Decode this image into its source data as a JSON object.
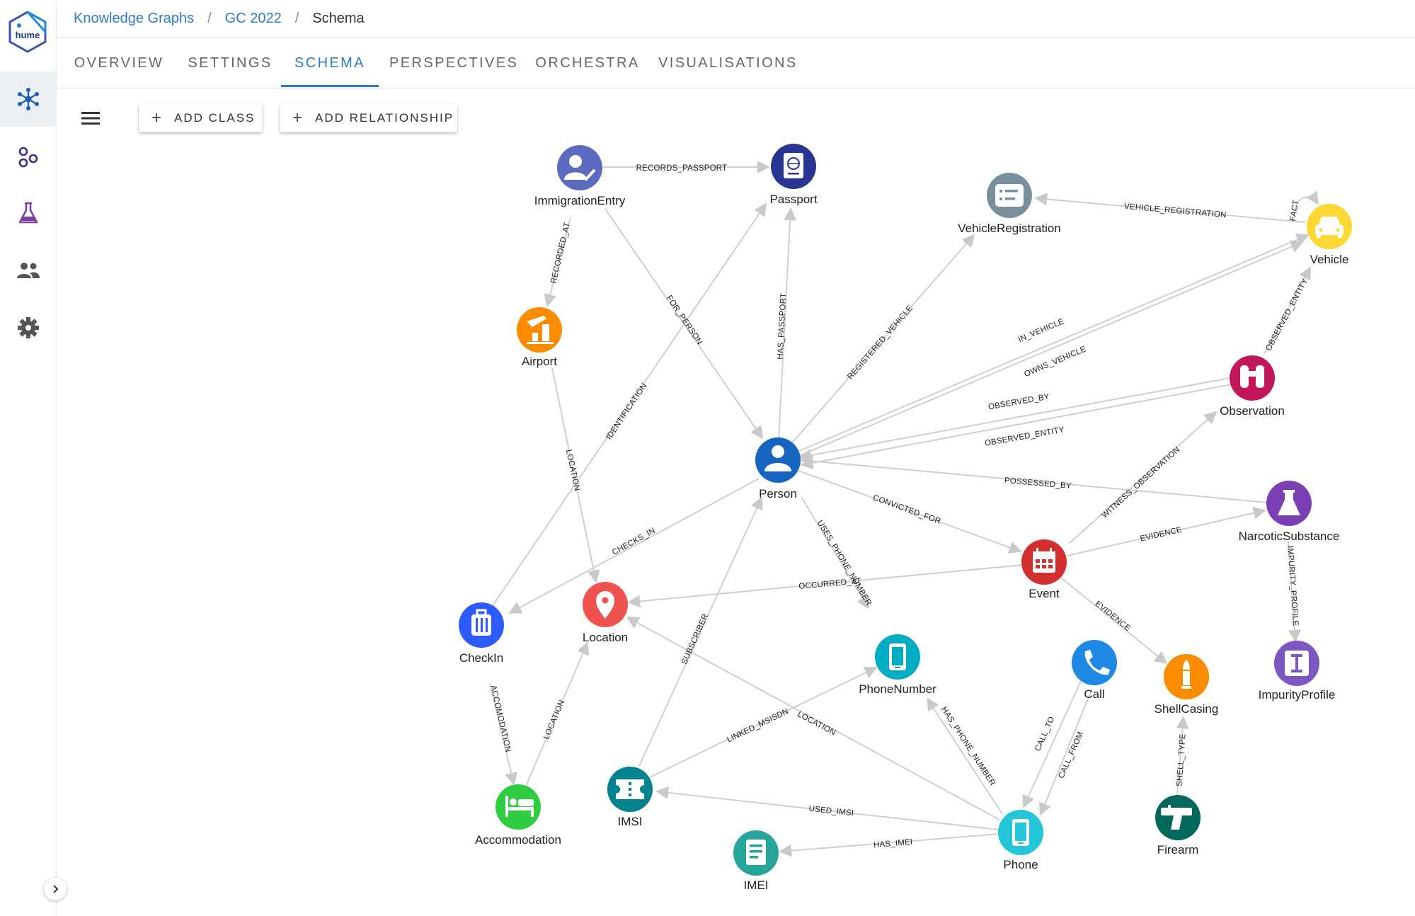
{
  "app": {
    "logo_text": "hume"
  },
  "breadcrumb": {
    "item1": "Knowledge Graphs",
    "item2": "GC 2022",
    "current": "Schema",
    "separator": "/"
  },
  "tabs": {
    "overview": "OVERVIEW",
    "settings": "SETTINGS",
    "schema": "SCHEMA",
    "perspectives": "PERSPECTIVES",
    "orchestra": "ORCHESTRA",
    "visualisations": "VISUALISATIONS"
  },
  "toolbar": {
    "add_class": "ADD CLASS",
    "add_relationship": "ADD RELATIONSHIP",
    "plus": "+"
  },
  "sidebar": {
    "items": [
      {
        "icon": "graph-network-icon",
        "active": true
      },
      {
        "icon": "nodes-icon",
        "active": false
      },
      {
        "icon": "flask-icon",
        "active": false
      },
      {
        "icon": "people-icon",
        "active": false
      },
      {
        "icon": "gear-icon",
        "active": false
      }
    ]
  },
  "colors": {
    "accent": "#2d7bc4",
    "edge": "#cccccc"
  },
  "graph": {
    "nodes": {
      "immigration_entry": {
        "label": "ImmigrationEntry",
        "color": "#5c6bc0",
        "icon": "person-check-icon"
      },
      "passport": {
        "label": "Passport",
        "color": "#283593",
        "icon": "passport-icon"
      },
      "vehicle_registration": {
        "label": "VehicleRegistration",
        "color": "#78909c",
        "icon": "list-card-icon"
      },
      "vehicle": {
        "label": "Vehicle",
        "color": "#fdd835",
        "icon": "car-icon"
      },
      "airport": {
        "label": "Airport",
        "color": "#fb8c00",
        "icon": "airport-icon"
      },
      "observation": {
        "label": "Observation",
        "color": "#c2185b",
        "icon": "binoculars-icon"
      },
      "person": {
        "label": "Person",
        "color": "#1565c0",
        "icon": "person-icon"
      },
      "narcotic_substance": {
        "label": "NarcoticSubstance",
        "color": "#7b3fb5",
        "icon": "flask-icon"
      },
      "event": {
        "label": "Event",
        "color": "#d32f2f",
        "icon": "calendar-icon"
      },
      "checkin": {
        "label": "CheckIn",
        "color": "#2d5bff",
        "icon": "luggage-icon"
      },
      "location": {
        "label": "Location",
        "color": "#ef5350",
        "icon": "location-pin-icon"
      },
      "phone_number": {
        "label": "PhoneNumber",
        "color": "#00acc1",
        "icon": "smartphone-icon"
      },
      "call": {
        "label": "Call",
        "color": "#1e88e5",
        "icon": "phone-call-icon"
      },
      "shell_casing": {
        "label": "ShellCasing",
        "color": "#fb8c00",
        "icon": "bullet-icon"
      },
      "impurity_profile": {
        "label": "ImpurityProfile",
        "color": "#7e57c2",
        "icon": "text-cursor-icon"
      },
      "accommodation": {
        "label": "Accommodation",
        "color": "#2ecc40",
        "icon": "bed-icon"
      },
      "imsi": {
        "label": "IMSI",
        "color": "#00838f",
        "icon": "sim-ticket-icon"
      },
      "phone": {
        "label": "Phone",
        "color": "#26c6da",
        "icon": "smartphone-icon"
      },
      "firearm": {
        "label": "Firearm",
        "color": "#00695c",
        "icon": "pistol-icon"
      },
      "imei": {
        "label": "IMEI",
        "color": "#26a69a",
        "icon": "document-icon"
      }
    },
    "edges": {
      "records_passport": "RECORDS_PASSPORT",
      "recorded_at": "RECORDED_AT",
      "for_person": "FOR_PERSON",
      "has_passport": "HAS_PASSPORT",
      "identification": "IDENTIFICATION",
      "vehicle_registration": "VEHICLE_REGISTRATION",
      "fact": "FACT",
      "registered_vehicle": "REGISTERED_VEHICLE",
      "in_vehicle": "IN_VEHICLE",
      "owns_vehicle": "OWNS_VEHICLE",
      "observed_entity_vehicle": "OBSERVED_ENTITY",
      "observed_by": "OBSERVED_BY",
      "observed_entity_person": "OBSERVED_ENTITY",
      "location_airport": "LOCATION",
      "possessed_by": "POSSESSED_BY",
      "witness_observation": "WITNESS_OBSERVATION",
      "convicted_for": "CONVICTED_FOR",
      "checks_in": "CHECKS_IN",
      "uses_phone_number": "USES_PHONE_NUMBER",
      "evidence_narcotic": "EVIDENCE",
      "occurred_at": "OCCURRED_AT",
      "impurity_profile": "IMPURITY_PROFILE",
      "evidence_shell": "EVIDENCE",
      "subscriber": "SUBSCRIBER",
      "accomodation": "ACCOMODATION",
      "location_accommodation": "LOCATION",
      "linked_msisdn": "LINKED_MSISDN",
      "location_phone": "LOCATION",
      "has_phone_number": "HAS_PHONE_NUMBER",
      "call_to": "CALL_TO",
      "call_from": "CALL_FROM",
      "shell_type": "SHELL_TYPE",
      "used_imsi": "USED_IMSI",
      "has_imei": "HAS_IMEI"
    }
  }
}
